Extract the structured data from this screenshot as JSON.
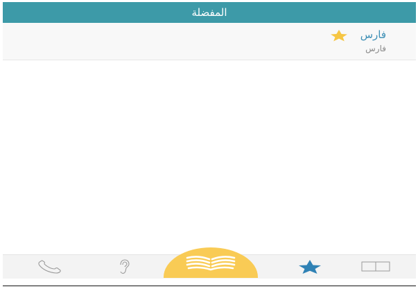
{
  "header": {
    "title": "المفضلة"
  },
  "favorites": {
    "items": [
      {
        "title": "فارس",
        "subtitle": "فارس",
        "star_icon": "star-icon",
        "star_color": "#f6c644"
      }
    ]
  },
  "tabbar": {
    "tabs": [
      {
        "id": "contact",
        "icon": "phone-icon"
      },
      {
        "id": "hearing",
        "icon": "ear-icon"
      },
      {
        "id": "read",
        "icon": "open-book-icon",
        "active_bg": "#f9cb55"
      },
      {
        "id": "favorites",
        "icon": "star-icon",
        "color": "#2f82b5"
      },
      {
        "id": "index",
        "icon": "book-icon"
      }
    ]
  },
  "colors": {
    "header_bg": "#3d9aa8",
    "accent": "#3d8fb5"
  }
}
